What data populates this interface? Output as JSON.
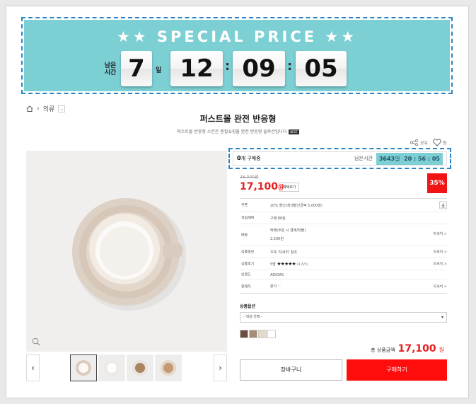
{
  "banner": {
    "title": "★★ SPECIAL PRICE ★★",
    "remain_label": "남은 시간",
    "days": "7",
    "days_unit": "일",
    "hours": "12",
    "minutes": "09",
    "seconds": "05",
    "colon": ":"
  },
  "breadcrumb": {
    "category": "의류"
  },
  "product": {
    "title": "퍼스트몰 완전 반응형",
    "description": "퍼스트몰 반응형 스킨은 종합쇼핑몰 완전 반응형 솔루션입니다",
    "best_badge": "BEST",
    "share_label": "공유",
    "wish_label": "찜"
  },
  "timerbox": {
    "count": "0",
    "count_label": "개 구매중",
    "remain_label": "남은시간",
    "days_value": "3643",
    "days_unit": "일",
    "time_value": "20 : 56 : 05"
  },
  "pricing": {
    "original": "26,000원",
    "price": "17,100",
    "price_unit": "원",
    "benefit_button": "혜택보기",
    "discount": "35%"
  },
  "info": {
    "coupon_label": "쿠폰",
    "coupon_value": "20% 할인(최대할인금액 5,000원)",
    "points_label": "적립혜택",
    "points_value": "구매 86원",
    "shipping_label": "배송",
    "shipping_value": "택배(주문 시 결제/착불)",
    "shipping_fee": "2,500원",
    "detail_link": "자세히 >",
    "product_info_label": "상품정보",
    "product_info_value": "우측 '자세히' 참조",
    "review_label": "상품후기",
    "review_count": "5명",
    "review_stars": "★★★★★",
    "review_score": "(4.8/5)",
    "brand_label": "브랜드",
    "brand_value": "ADIDAS",
    "seller_label": "판매자",
    "seller_value": "본사"
  },
  "options": {
    "label": "상품옵션",
    "select_placeholder": "- 색상 선택 -",
    "swatch_colors": [
      "#6b4f3a",
      "#a88c75",
      "#e5d9c8",
      "#ffffff"
    ]
  },
  "total": {
    "label": "총 상품금액",
    "value": "17,100",
    "unit": "원"
  },
  "buttons": {
    "cart": "장바구니",
    "buy": "구매하기"
  },
  "colors": {
    "accent": "#7ccfd3",
    "price": "#e61e1e",
    "buy": "#ff0d0d"
  }
}
